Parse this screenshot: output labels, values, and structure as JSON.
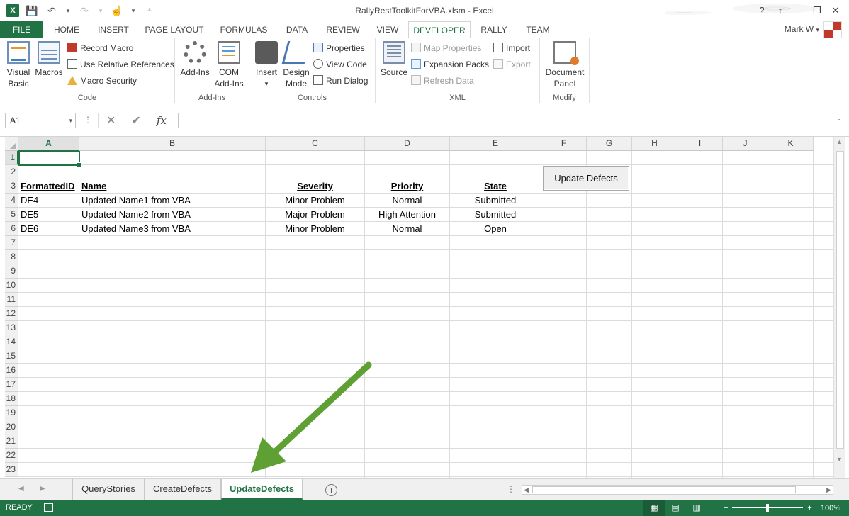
{
  "window": {
    "title": "RallyRestToolkitForVBA.xlsm - Excel",
    "app_icon": "X",
    "help": "?",
    "ribbon_display": "↑",
    "minimize": "—",
    "restore": "❐",
    "close": "✕",
    "user": "Mark W",
    "user_dropdown": "▾"
  },
  "qat": {
    "save": "💾",
    "undo": "↶",
    "undo_dd": "▾",
    "redo": "↷",
    "redo_dd": "▾",
    "touch": "☝",
    "touch_dd": "▾",
    "customize": "⩡"
  },
  "tabs": [
    "FILE",
    "HOME",
    "INSERT",
    "PAGE LAYOUT",
    "FORMULAS",
    "DATA",
    "REVIEW",
    "VIEW",
    "DEVELOPER",
    "RALLY",
    "TEAM"
  ],
  "ribbon": {
    "code": {
      "label": "Code",
      "visual_basic": [
        "Visual",
        "Basic"
      ],
      "macros": "Macros",
      "record_macro": "Record Macro",
      "use_relative": "Use Relative References",
      "macro_security": "Macro Security"
    },
    "addins": {
      "label": "Add-Ins",
      "addins": "Add-Ins",
      "com": [
        "COM",
        "Add-Ins"
      ]
    },
    "controls": {
      "label": "Controls",
      "insert": "Insert",
      "insert_dd": "▾",
      "design": [
        "Design",
        "Mode"
      ],
      "properties": "Properties",
      "view_code": "View Code",
      "run_dialog": "Run Dialog"
    },
    "xml": {
      "label": "XML",
      "source": "Source",
      "map_properties": "Map Properties",
      "expansion_packs": "Expansion Packs",
      "refresh_data": "Refresh Data",
      "import": "Import",
      "export": "Export"
    },
    "modify": {
      "label": "Modify",
      "document_panel": [
        "Document",
        "Panel"
      ]
    }
  },
  "formula_bar": {
    "name_box": "A1",
    "name_dd": "▾",
    "dots": "⋮",
    "cancel": "✕",
    "enter": "✔",
    "fx": "fx",
    "value": "",
    "expand": "⌄"
  },
  "columns": [
    "A",
    "B",
    "C",
    "D",
    "E",
    "F",
    "G",
    "H",
    "I",
    "J",
    "K"
  ],
  "rows": [
    "1",
    "2",
    "3",
    "4",
    "5",
    "6",
    "7",
    "8",
    "9",
    "10",
    "11",
    "12",
    "13",
    "14",
    "15",
    "16",
    "17",
    "18",
    "19",
    "20",
    "21",
    "22",
    "23"
  ],
  "table": {
    "headers": [
      "FormattedID",
      "Name",
      "Severity",
      "Priority",
      "State"
    ],
    "rows": [
      [
        "DE4",
        "Updated Name1 from VBA",
        "Minor Problem",
        "Normal",
        "Submitted"
      ],
      [
        "DE5",
        "Updated Name2 from VBA",
        "Major Problem",
        "High Attention",
        "Submitted"
      ],
      [
        "DE6",
        "Updated Name3 from VBA",
        "Minor Problem",
        "Normal",
        "Open"
      ]
    ]
  },
  "form_button": "Update Defects",
  "sheets": [
    "QueryStories",
    "CreateDefects",
    "UpdateDefects"
  ],
  "active_sheet": "UpdateDefects",
  "sheet_nav": {
    "prev": "◀",
    "next": "▶",
    "add": "+",
    "dots": "⋮"
  },
  "scroll_arrows": {
    "up": "▲",
    "down": "▼",
    "left": "◀",
    "right": "▶"
  },
  "status": {
    "ready": "READY",
    "view_normal": "▦",
    "view_layout": "▤",
    "view_break": "▥",
    "zoom_out": "−",
    "zoom_in": "+",
    "zoom": "100%",
    "zoom_fraction": 0.5
  },
  "colors": {
    "accent": "#217346",
    "arrow": "#5ea033"
  }
}
